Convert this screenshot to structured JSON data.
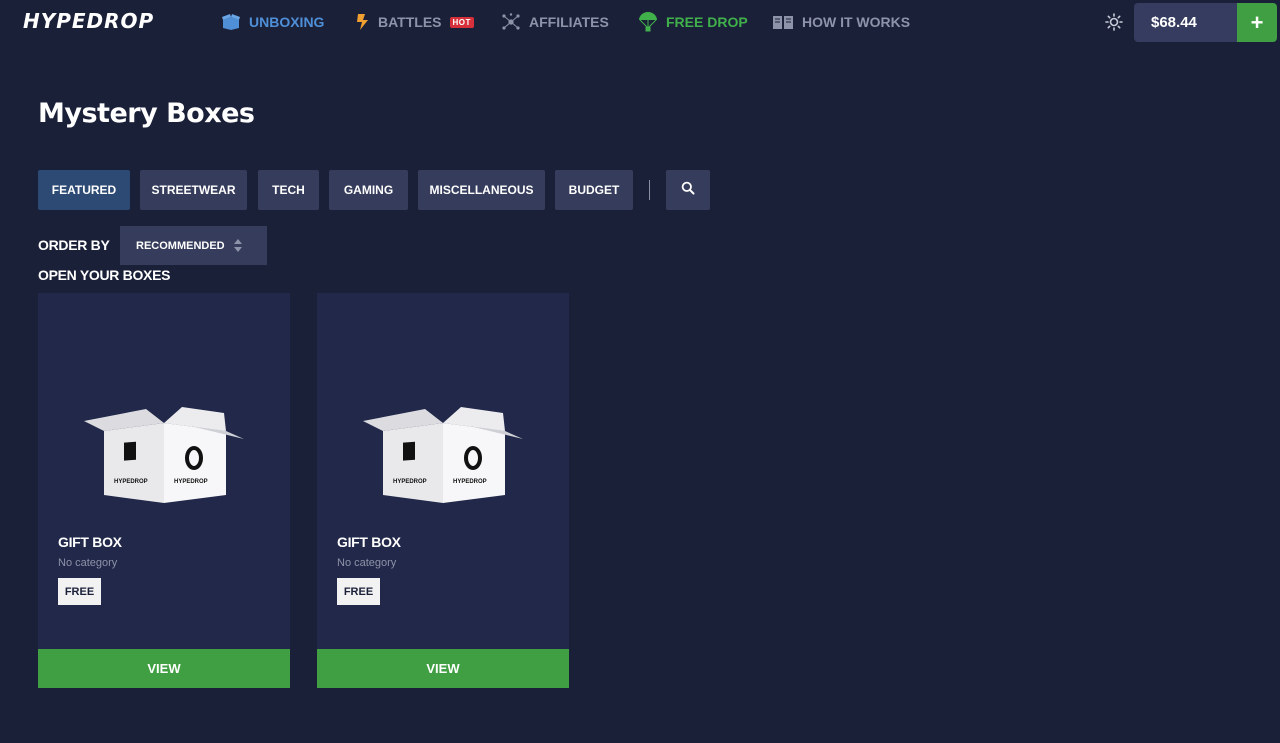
{
  "brand": {
    "logo": "HYPEDROP"
  },
  "nav": {
    "unboxing": "UNBOXING",
    "battles": "BATTLES",
    "battles_badge": "HOT",
    "affiliates": "AFFILIATES",
    "free_drop": "FREE DROP",
    "how_it_works": "HOW IT WORKS",
    "icons": [
      "box-icon",
      "lightning-icon",
      "network-icon",
      "parachute-icon",
      "book-icon"
    ]
  },
  "header": {
    "balance": "$68.44",
    "add_funds_label": "+",
    "theme_icon": "sun-icon"
  },
  "page": {
    "title": "Mystery Boxes"
  },
  "tabs": [
    {
      "label": "FEATURED",
      "active": true
    },
    {
      "label": "STREETWEAR",
      "active": false
    },
    {
      "label": "TECH",
      "active": false
    },
    {
      "label": "GAMING",
      "active": false
    },
    {
      "label": "MISCELLANEOUS",
      "active": false
    },
    {
      "label": "BUDGET",
      "active": false
    }
  ],
  "order": {
    "label": "ORDER BY",
    "selected": "RECOMMENDED"
  },
  "section": {
    "label": "OPEN YOUR BOXES"
  },
  "boxes": [
    {
      "name": "GIFT BOX",
      "category": "No category",
      "price": "FREE",
      "button": "VIEW",
      "box_print": "HYPEDROP"
    },
    {
      "name": "GIFT BOX",
      "category": "No category",
      "price": "FREE",
      "button": "VIEW",
      "box_print": "HYPEDROP"
    }
  ],
  "colors": {
    "background": "#1b2039",
    "card": "#212849",
    "tab": "#363c5b",
    "tab_active": "#2c4a74",
    "accent_green": "#3f9f42",
    "accent_blue": "#4e8fd8",
    "hot_red": "#d6303a"
  }
}
